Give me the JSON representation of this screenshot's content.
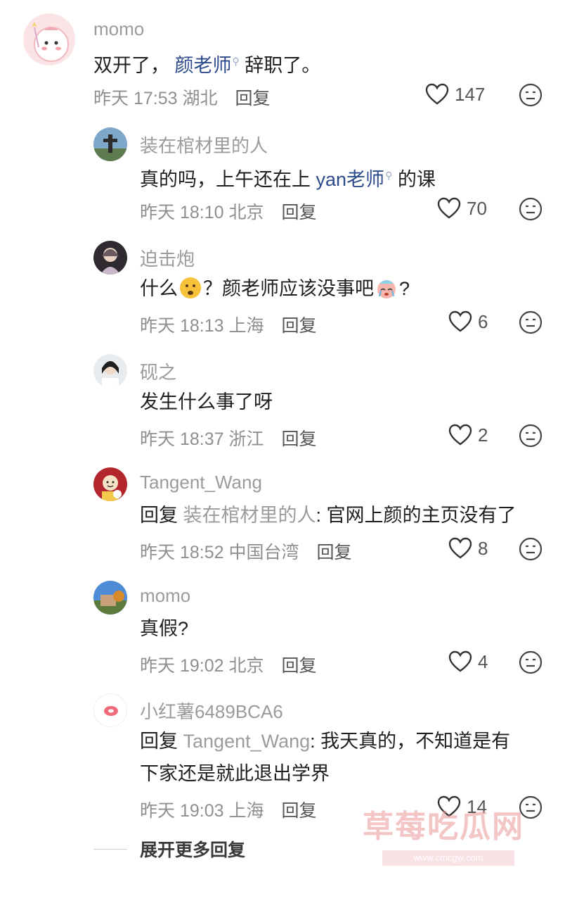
{
  "comments": [
    {
      "username": "momo",
      "text_pre": "双开了，",
      "mention": "颜老师",
      "text_post": "辞职了。",
      "time": "昨天 17:53",
      "location": "湖北",
      "reply_label": "回复",
      "likes": "147"
    },
    {
      "username": "装在棺材里的人",
      "text_pre": "真的吗，上午还在上",
      "mention": "yan老师",
      "text_post": "的课",
      "time": "昨天 18:10",
      "location": "北京",
      "reply_label": "回复",
      "likes": "70"
    },
    {
      "username": "迫击炮",
      "text_a": "什么",
      "text_b": "？颜老师应该没事吧",
      "text_c": "?",
      "time": "昨天 18:13",
      "location": "上海",
      "reply_label": "回复",
      "likes": "6",
      "emoji_1": "worried-face",
      "emoji_2": "crying-face"
    },
    {
      "username": "砚之",
      "text": "发生什么事了呀",
      "time": "昨天 18:37",
      "location": "浙江",
      "reply_label": "回复",
      "likes": "2"
    },
    {
      "username": "Tangent_Wang",
      "reply_prefix": "回复",
      "reply_to": "装在棺材里的人",
      "text": ": 官网上颜的主页没有了",
      "time": "昨天 18:52",
      "location": "中国台湾",
      "reply_label": "回复",
      "likes": "8"
    },
    {
      "username": "momo",
      "text": "真假?",
      "time": "昨天 19:02",
      "location": "北京",
      "reply_label": "回复",
      "likes": "4"
    },
    {
      "username": "小红薯6489BCA6",
      "reply_prefix": "回复",
      "reply_to": "Tangent_Wang",
      "text_line1": ": 我天真的，不知道是有",
      "text_line2": "下家还是就此退出学界",
      "time": "昨天 19:03",
      "location": "上海",
      "reply_label": "回复",
      "likes": "14"
    }
  ],
  "expand_more": "展开更多回复",
  "watermark": {
    "title": "草莓吃瓜网",
    "url": "www.cmcgw.com"
  },
  "colors": {
    "mention": "#2c4a8b",
    "muted": "#9b9b9b",
    "text": "#1f1f1f"
  }
}
